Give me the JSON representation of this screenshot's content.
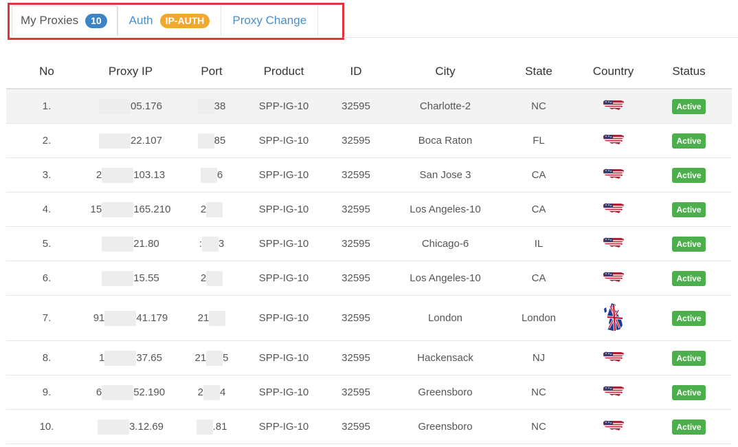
{
  "tabs": [
    {
      "label": "My Proxies",
      "badge": "10",
      "badge_color": "#3c84c6",
      "active": true
    },
    {
      "label": "Auth",
      "badge": "IP-AUTH",
      "badge_color": "#f0a830",
      "active": false
    },
    {
      "label": "Proxy Change",
      "badge": "",
      "active": false
    }
  ],
  "table": {
    "headers": [
      "No",
      "Proxy IP",
      "Port",
      "Product",
      "ID",
      "City",
      "State",
      "Country",
      "Status"
    ],
    "rows": [
      {
        "no": "1.",
        "ip_prefix": "",
        "ip_suffix": "05.176",
        "port_prefix": "",
        "port_suffix": "38",
        "product": "SPP-IG-10",
        "id": "32595",
        "city": "Charlotte-2",
        "state": "NC",
        "country_icon": "us-flag-icon",
        "status": "Active"
      },
      {
        "no": "2.",
        "ip_prefix": "",
        "ip_suffix": "22.107",
        "port_prefix": "",
        "port_suffix": "85",
        "product": "SPP-IG-10",
        "id": "32595",
        "city": "Boca Raton",
        "state": "FL",
        "country_icon": "us-flag-icon",
        "status": "Active"
      },
      {
        "no": "3.",
        "ip_prefix": "2",
        "ip_suffix": "103.13",
        "port_prefix": "",
        "port_suffix": "6",
        "product": "SPP-IG-10",
        "id": "32595",
        "city": "San Jose 3",
        "state": "CA",
        "country_icon": "us-flag-icon",
        "status": "Active"
      },
      {
        "no": "4.",
        "ip_prefix": "15",
        "ip_suffix": "165.210",
        "port_prefix": "2",
        "port_suffix": "",
        "product": "SPP-IG-10",
        "id": "32595",
        "city": "Los Angeles-10",
        "state": "CA",
        "country_icon": "us-flag-icon",
        "status": "Active"
      },
      {
        "no": "5.",
        "ip_prefix": "",
        "ip_suffix": "21.80",
        "port_prefix": ":",
        "port_suffix": "3",
        "product": "SPP-IG-10",
        "id": "32595",
        "city": "Chicago-6",
        "state": "IL",
        "country_icon": "us-flag-icon",
        "status": "Active"
      },
      {
        "no": "6.",
        "ip_prefix": "",
        "ip_suffix": "15.55",
        "port_prefix": "2",
        "port_suffix": "",
        "product": "SPP-IG-10",
        "id": "32595",
        "city": "Los Angeles-10",
        "state": "CA",
        "country_icon": "us-flag-icon",
        "status": "Active"
      },
      {
        "no": "7.",
        "ip_prefix": "91",
        "ip_suffix": "41.179",
        "port_prefix": "21",
        "port_suffix": "",
        "product": "SPP-IG-10",
        "id": "32595",
        "city": "London",
        "state": "London",
        "country_icon": "uk-flag-icon",
        "status": "Active"
      },
      {
        "no": "8.",
        "ip_prefix": "1",
        "ip_suffix": "37.65",
        "port_prefix": "21",
        "port_suffix": "5",
        "product": "SPP-IG-10",
        "id": "32595",
        "city": "Hackensack",
        "state": "NJ",
        "country_icon": "us-flag-icon",
        "status": "Active"
      },
      {
        "no": "9.",
        "ip_prefix": "6",
        "ip_suffix": "52.190",
        "port_prefix": "2",
        "port_suffix": "4",
        "product": "SPP-IG-10",
        "id": "32595",
        "city": "Greensboro",
        "state": "NC",
        "country_icon": "us-flag-icon",
        "status": "Active"
      },
      {
        "no": "10.",
        "ip_prefix": "",
        "ip_suffix": "3.12.69",
        "port_prefix": "",
        "port_suffix": ".81",
        "product": "SPP-IG-10",
        "id": "32595",
        "city": "Greensboro",
        "state": "NC",
        "country_icon": "us-flag-icon",
        "status": "Active"
      }
    ]
  },
  "colors": {
    "active_status": "#4cae4c",
    "highlight_outline": "#e0333a",
    "link": "#4a8fc9"
  }
}
